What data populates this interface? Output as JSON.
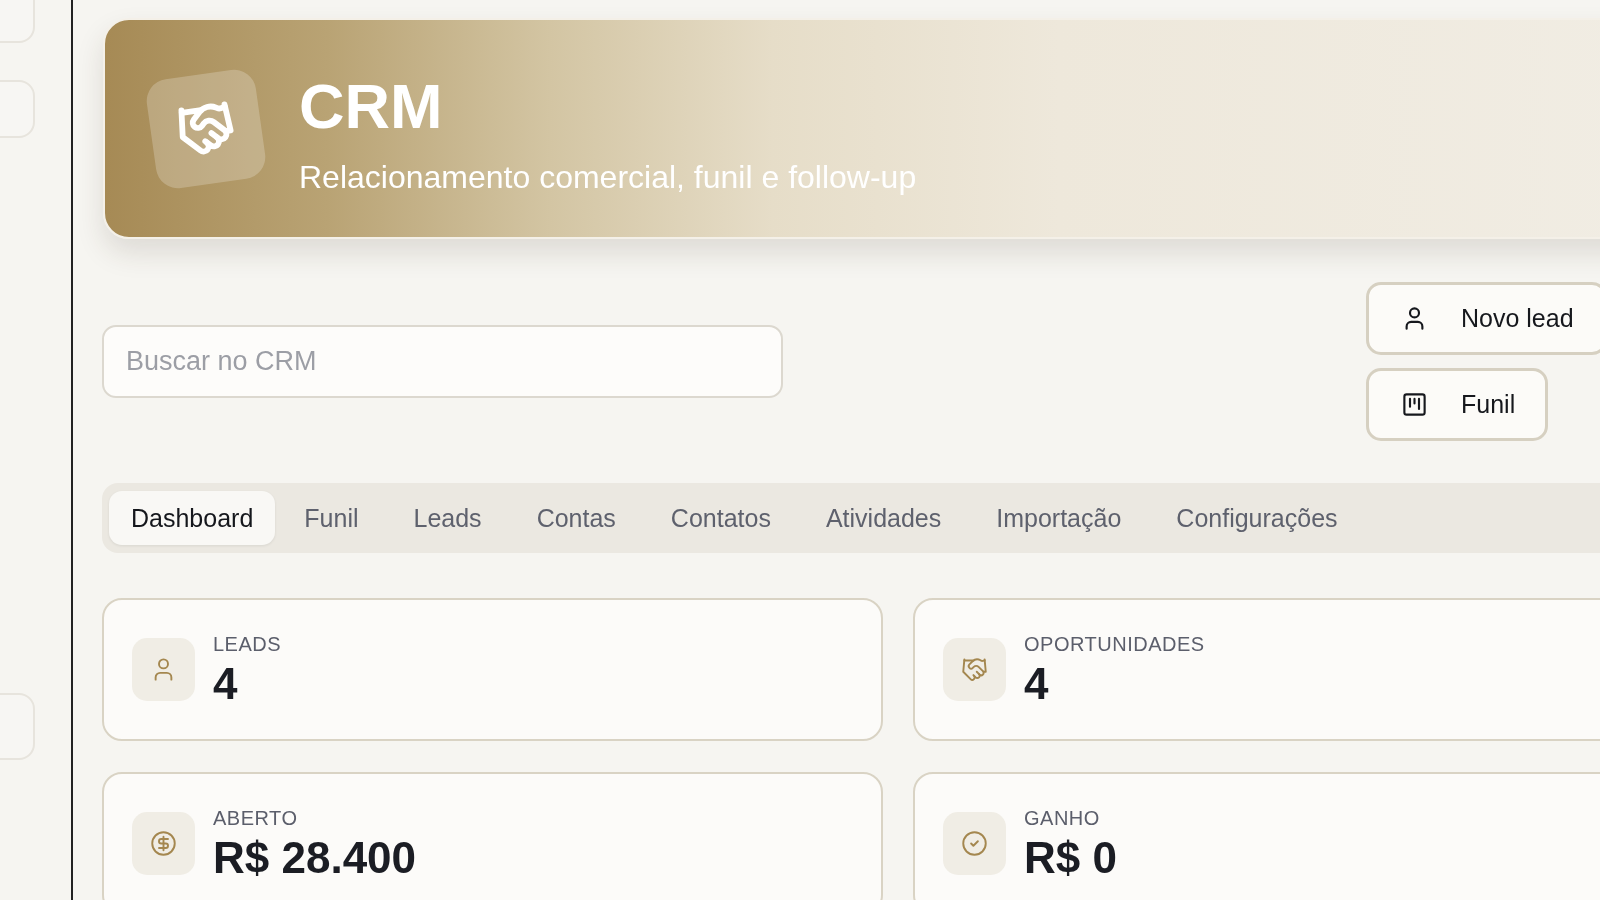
{
  "header": {
    "title": "CRM",
    "subtitle": "Relacionamento comercial, funil e follow-up"
  },
  "search": {
    "placeholder": "Buscar no CRM"
  },
  "actions": [
    {
      "label": "Novo lead"
    },
    {
      "label": "Funil"
    }
  ],
  "tabs": [
    {
      "label": "Dashboard",
      "selected": true
    },
    {
      "label": "Funil",
      "selected": false
    },
    {
      "label": "Leads",
      "selected": false
    },
    {
      "label": "Contas",
      "selected": false
    },
    {
      "label": "Contatos",
      "selected": false
    },
    {
      "label": "Atividades",
      "selected": false
    },
    {
      "label": "Importação",
      "selected": false
    },
    {
      "label": "Configurações",
      "selected": false
    }
  ],
  "stats": [
    {
      "label": "LEADS",
      "value": "4"
    },
    {
      "label": "OPORTUNIDADES",
      "value": "4"
    },
    {
      "label": "ABERTO",
      "value": "R$ 28.400"
    },
    {
      "label": "GANHO",
      "value": "R$ 0"
    }
  ]
}
